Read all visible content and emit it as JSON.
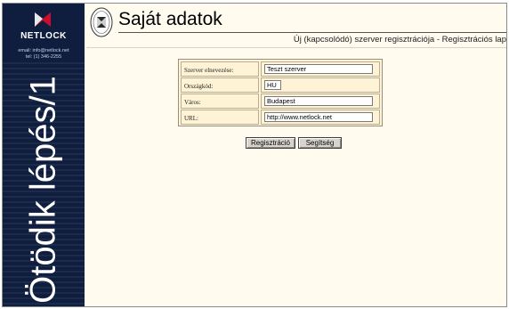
{
  "sidebar": {
    "logo_text": "NETLOCK",
    "email": "email: info@netlock.net",
    "tel": "tel: (1) 346-2255",
    "vertical_title": "Ötödik lépés/1"
  },
  "header": {
    "title": "Saját adatok",
    "subtitle": "Új (kapcsolódó) szerver regisztrációja - Regisztrációs lap"
  },
  "form": {
    "fields": [
      {
        "label": "Szerver elnevezése:",
        "value": "Teszt szerver"
      },
      {
        "label": "Országkód:",
        "value": "HU"
      },
      {
        "label": "Város:",
        "value": "Budapest"
      },
      {
        "label": "URL:",
        "value": "http://www.netlock.net"
      }
    ]
  },
  "buttons": {
    "register": "Regisztráció",
    "help": "Segítség"
  },
  "colors": {
    "sidebar_bg": "#0f1e3f",
    "page_bg": "#fffbef",
    "form_bg": "#fff3d6",
    "logo_accent": "#c8102e"
  }
}
